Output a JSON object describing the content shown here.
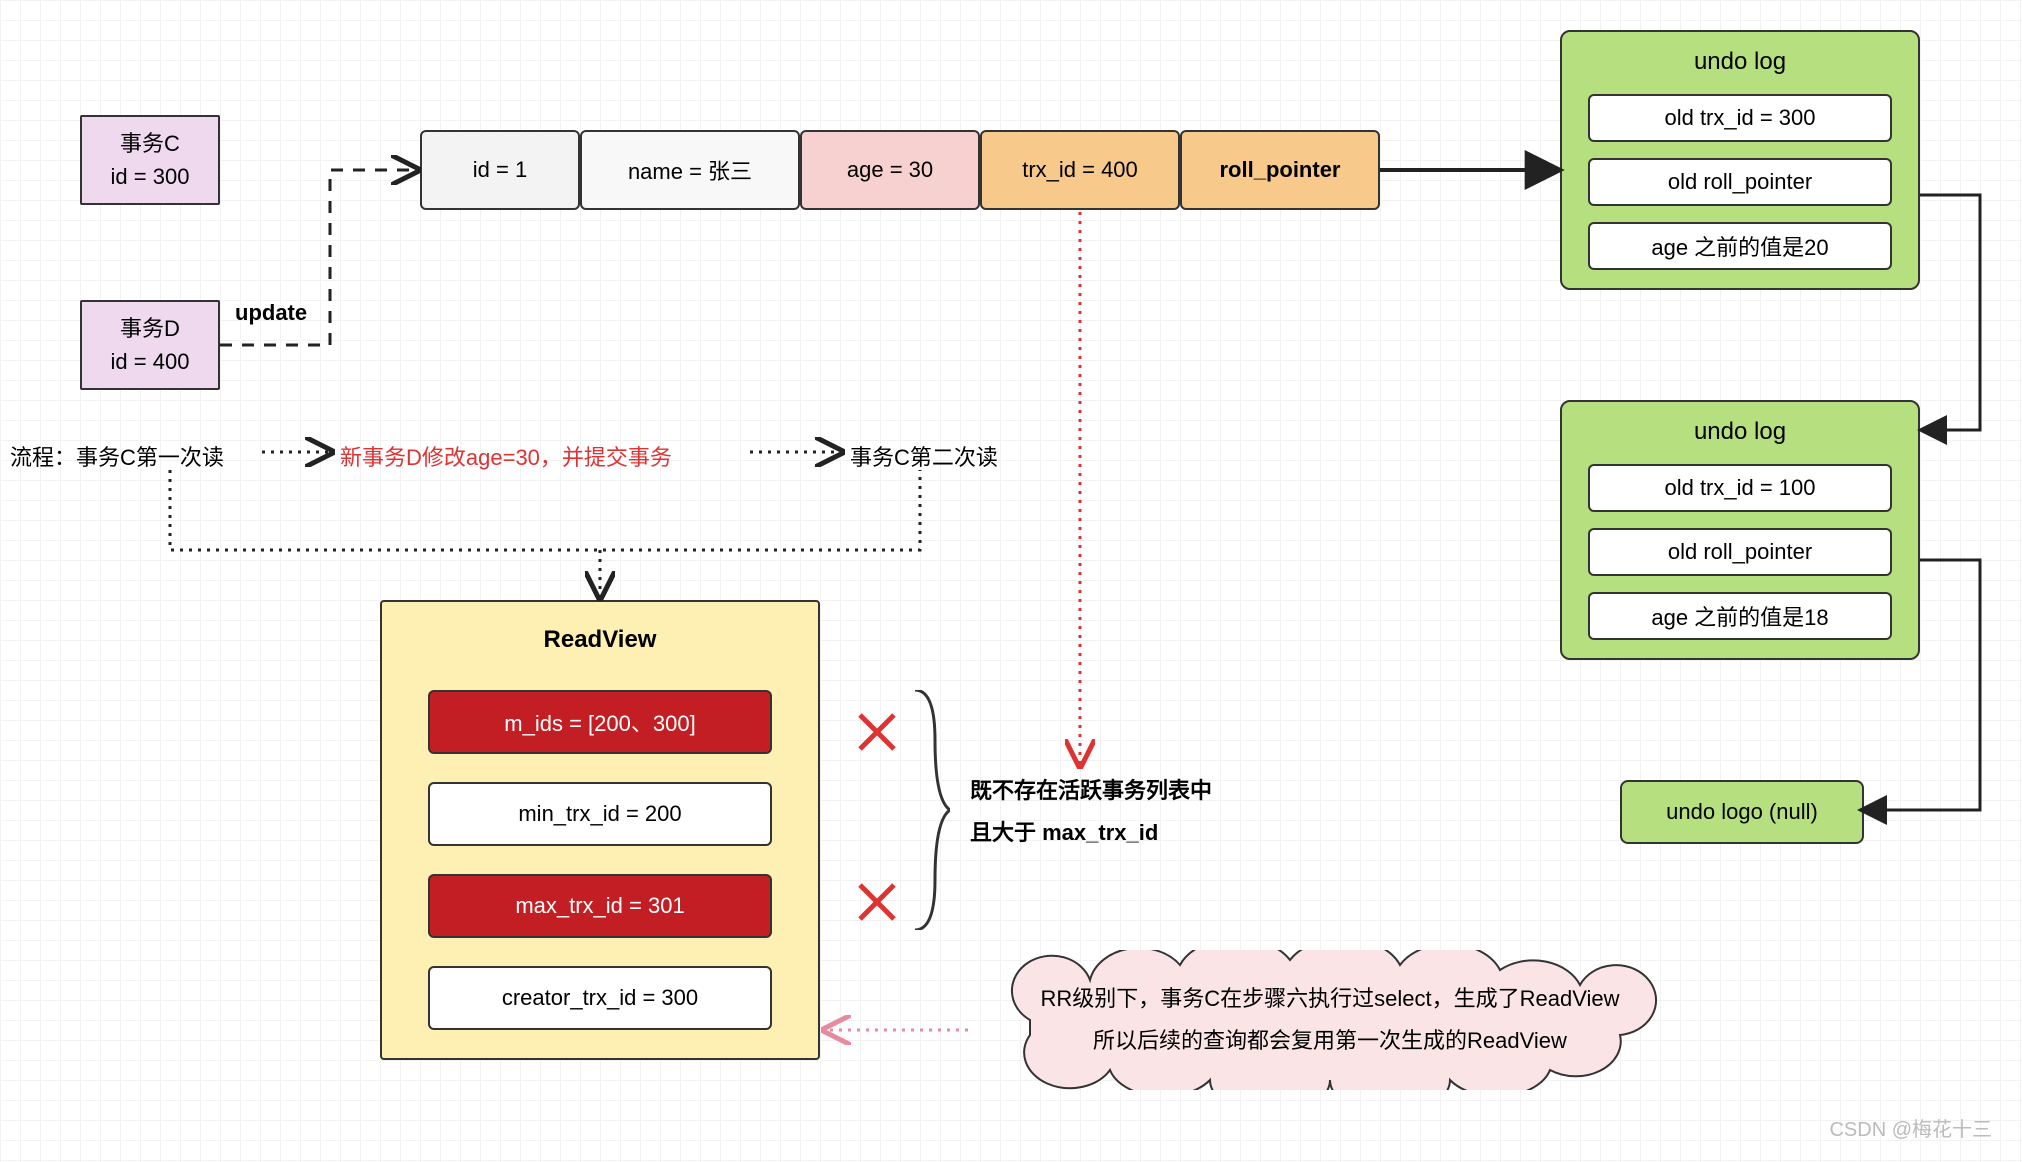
{
  "transactions": {
    "c_label": "事务C",
    "c_id": "id = 300",
    "d_label": "事务D",
    "d_id": "id = 400",
    "update_label": "update"
  },
  "row": {
    "id": "id = 1",
    "name": "name = 张三",
    "age": "age = 30",
    "trx_id": "trx_id = 400",
    "roll_pointer": "roll_pointer"
  },
  "undo1": {
    "title": "undo log",
    "trx": "old trx_id = 300",
    "roll": "old roll_pointer",
    "age": "age 之前的值是20"
  },
  "undo2": {
    "title": "undo log",
    "trx": "old trx_id = 100",
    "roll": "old roll_pointer",
    "age": "age 之前的值是18"
  },
  "undo_null": "undo logo (null)",
  "flow": {
    "prefix": "流程：",
    "step1": "事务C第一次读",
    "step2": "新事务D修改age=30，并提交事务",
    "step3": "事务C第二次读"
  },
  "readview": {
    "title": "ReadView",
    "m_ids": "m_ids = [200、300]",
    "min": "min_trx_id = 200",
    "max": "max_trx_id = 301",
    "creator": "creator_trx_id = 300"
  },
  "annotation": {
    "line1": "既不存在活跃事务列表中",
    "line2": "且大于 max_trx_id"
  },
  "callout": {
    "line1": "RR级别下，事务C在步骤六执行过select，生成了ReadView",
    "line2": "所以后续的查询都会复用第一次生成的ReadView"
  },
  "watermark": "CSDN @梅花十三"
}
